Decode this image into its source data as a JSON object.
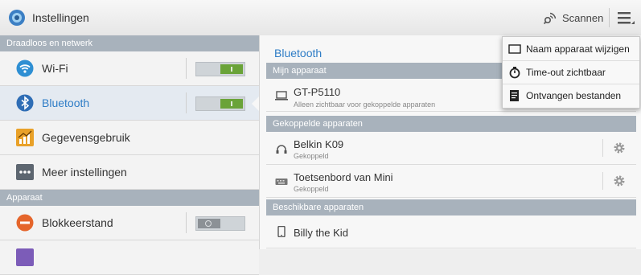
{
  "header": {
    "title": "Instellingen",
    "scan_label": "Scannen"
  },
  "left": {
    "sections": [
      {
        "label": "Draadloos en netwerk"
      },
      {
        "label": "Apparaat"
      }
    ],
    "items": [
      {
        "label": "Wi-Fi",
        "toggle": "on"
      },
      {
        "label": "Bluetooth",
        "toggle": "on",
        "selected": true
      },
      {
        "label": "Gegevensgebruik"
      },
      {
        "label": "Meer instellingen"
      },
      {
        "label": "Blokkeerstand",
        "toggle": "off"
      }
    ]
  },
  "right": {
    "title": "Bluetooth",
    "my_device_section": "Mijn apparaat",
    "my_device": {
      "name": "GT-P5110",
      "sub": "Alleen zichtbaar voor gekoppelde apparaten"
    },
    "paired_section": "Gekoppelde apparaten",
    "paired": [
      {
        "name": "Belkin K09",
        "sub": "Gekoppeld"
      },
      {
        "name": "Toetsenbord van Mini",
        "sub": "Gekoppeld"
      }
    ],
    "available_section": "Beschikbare apparaten",
    "available": [
      {
        "name": "Billy the Kid"
      }
    ]
  },
  "menu": {
    "items": [
      {
        "label": "Naam apparaat wijzigen",
        "icon": "rename-icon"
      },
      {
        "label": "Time-out zichtbaar",
        "icon": "timer-icon"
      },
      {
        "label": "Ontvangen bestanden",
        "icon": "received-files-icon"
      }
    ]
  },
  "colors": {
    "accent": "#2f7dc6",
    "section": "#a8b2bc",
    "toggle_on": "#6aa338"
  }
}
